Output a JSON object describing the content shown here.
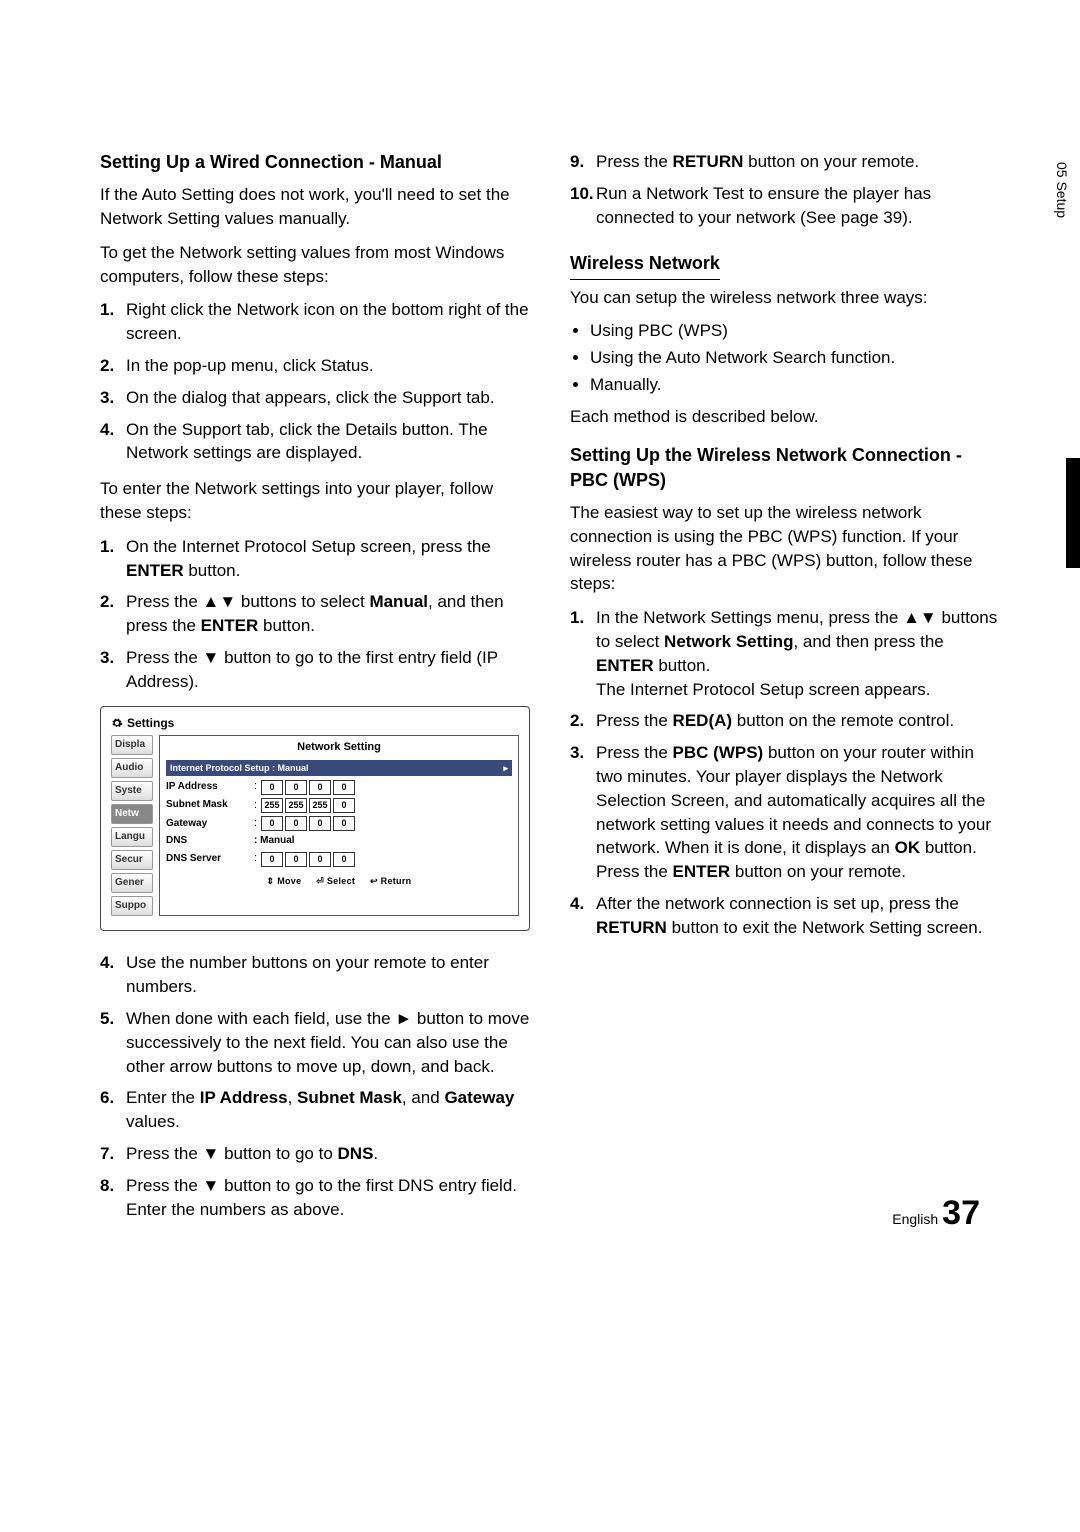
{
  "sidetab": "05 Setup",
  "left": {
    "h1": "Setting Up a Wired Connection - Manual",
    "p1": "If the Auto Setting does not work, you'll need to set the Network Setting values manually.",
    "p2": "To get the Network setting values from most Windows computers, follow these steps:",
    "listA": [
      "Right click the Network icon on the bottom right of the screen.",
      "In the pop-up menu, click Status.",
      "On the dialog that appears, click the Support tab.",
      "On the Support tab, click the Details button. The Network settings are displayed."
    ],
    "p3": "To enter the Network settings into your player, follow these steps:",
    "listB_1": "On the Internet Protocol Setup screen, press the ",
    "listB_1b": "ENTER",
    "listB_1c": " button.",
    "listB_2a": "Press the ▲▼ buttons to select ",
    "listB_2b": "Manual",
    "listB_2c": ", and then press the ",
    "listB_2d": "ENTER",
    "listB_2e": " button.",
    "listB_3": "Press the ▼ button to go to the first entry field (IP Address).",
    "listC_4": "Use the number buttons on your remote to enter numbers.",
    "listC_5": "When done with each field, use the ► button to move successively to the next field. You can also use the other arrow buttons to move up, down, and back.",
    "listC_6a": "Enter the ",
    "listC_6b": "IP Address",
    "listC_6c": ", ",
    "listC_6d": "Subnet Mask",
    "listC_6e": ", and ",
    "listC_6f": "Gateway",
    "listC_6g": " values.",
    "listC_7a": "Press the ▼ button to go to ",
    "listC_7b": "DNS",
    "listC_7c": ".",
    "listC_8": "Press the ▼ button to go to the first DNS entry field. Enter the numbers as above."
  },
  "right": {
    "listD_9a": "Press the ",
    "listD_9b": "RETURN",
    "listD_9c": " button on your remote.",
    "listD_10": "Run a Network Test to ensure the player has connected to your network (See page 39).",
    "h2": "Wireless Network",
    "p4": "You can setup the wireless network three ways:",
    "bullets": [
      "Using PBC (WPS)",
      "Using the Auto Network Search function.",
      "Manually."
    ],
    "p5": "Each method is described below.",
    "h3": "Setting Up the Wireless Network Connection - PBC (WPS)",
    "p6": "The easiest way to set up the wireless network connection is using the PBC (WPS) function. If your wireless router has a PBC (WPS) button, follow these steps:",
    "listE_1a": "In the Network Settings menu, press the ▲▼ buttons to select ",
    "listE_1b": "Network Setting",
    "listE_1c": ", and then press the ",
    "listE_1d": "ENTER",
    "listE_1e": " button.",
    "listE_1f": "The Internet Protocol Setup screen appears.",
    "listE_2a": "Press the ",
    "listE_2b": "RED(A)",
    "listE_2c": " button on the remote control.",
    "listE_3a": "Press the ",
    "listE_3b": "PBC (WPS)",
    "listE_3c": " button on your router within two minutes. Your player displays the Network Selection Screen, and automatically acquires all the network setting values it needs and connects to your network. When it is done, it displays an ",
    "listE_3d": "OK",
    "listE_3e": " button. Press the ",
    "listE_3f": "ENTER",
    "listE_3g": " button on your remote.",
    "listE_4a": "After the network connection is set up, press the ",
    "listE_4b": "RETURN",
    "listE_4c": " button to exit the Network Setting screen."
  },
  "settings": {
    "title": "Settings",
    "panelTitle": "Network Setting",
    "protocolLabel": "Internet Protocol Setup  : Manual",
    "rows": {
      "ipLabel": "IP Address",
      "ipVals": [
        "0",
        "0",
        "0",
        "0"
      ],
      "subnetLabel": "Subnet Mask",
      "subnetVals": [
        "255",
        "255",
        "255",
        "0"
      ],
      "gatewayLabel": "Gateway",
      "gatewayVals": [
        "0",
        "0",
        "0",
        "0"
      ],
      "dnsLabel": "DNS",
      "dnsMode": "Manual",
      "dnsServerLabel": "DNS Server",
      "dnsVals": [
        "0",
        "0",
        "0",
        "0"
      ]
    },
    "menu": [
      "Displa",
      "Audio",
      "Syste",
      "Netw",
      "Langu",
      "Secur",
      "Gener",
      "Suppo"
    ],
    "activeMenu": 3,
    "bottom": {
      "move": "⇕ Move",
      "select": "⏎ Select",
      "ret": "↩ Return"
    }
  },
  "pageNumber": {
    "lang": "English",
    "num": "37"
  }
}
